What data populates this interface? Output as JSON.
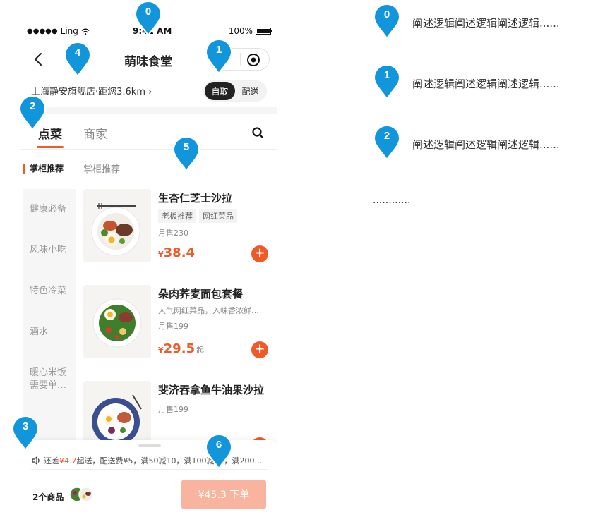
{
  "status_bar": {
    "carrier": "Ling",
    "time": "9:41 AM",
    "battery": "100%"
  },
  "nav": {
    "title": "萌味食堂"
  },
  "store": {
    "name": "上海静安旗舰店·距您3.6km",
    "modes": [
      "自取",
      "配送"
    ],
    "active_mode": "自取"
  },
  "tabs": {
    "order": "点菜",
    "merchant": "商家"
  },
  "section": {
    "active": "掌柜推荐",
    "inactive": "掌柜推荐"
  },
  "categories": [
    "健康必备",
    "风味小吃",
    "特色冷菜",
    "酒水",
    "暖心米饭需要单…"
  ],
  "products": [
    {
      "name": "生杏仁芝士沙拉",
      "tags": [
        "老板推荐",
        "网红菜品"
      ],
      "sales": "月售230",
      "currency": "¥",
      "price": "38.4",
      "suffix": ""
    },
    {
      "name": "朵肉荞麦面包套餐",
      "desc": "人气网红菜品，入味香浓鲜…",
      "sales": "月售199",
      "currency": "¥",
      "price": "29.5",
      "suffix": "起"
    },
    {
      "name": "斐济吞拿鱼牛油果沙拉",
      "sales": "月售199"
    }
  ],
  "add_label": "+",
  "bottom": {
    "notice_prefix": "还差",
    "notice_amount": "¥4.7",
    "notice_suffix": "起送，配送费¥5，满50减10，满100减30，满200…",
    "cart_count": "2个商品",
    "order_button": "¥45.3 下单"
  },
  "markers": [
    "0",
    "1",
    "2",
    "3",
    "4",
    "5",
    "6"
  ],
  "annotations": [
    {
      "number": "0",
      "text": "阐述逻辑阐述逻辑阐述逻辑......"
    },
    {
      "number": "1",
      "text": "阐述逻辑阐述逻辑阐述逻辑......"
    },
    {
      "number": "2",
      "text": "阐述逻辑阐述逻辑阐述逻辑......"
    }
  ],
  "annotations_more": "............",
  "colors": {
    "accent": "#f05a28",
    "marker": "#1296db",
    "order_button": "#f8b49e"
  },
  "icons": [
    "back-icon",
    "target-icon",
    "search-icon",
    "speaker-icon",
    "wifi-icon",
    "battery-icon"
  ]
}
